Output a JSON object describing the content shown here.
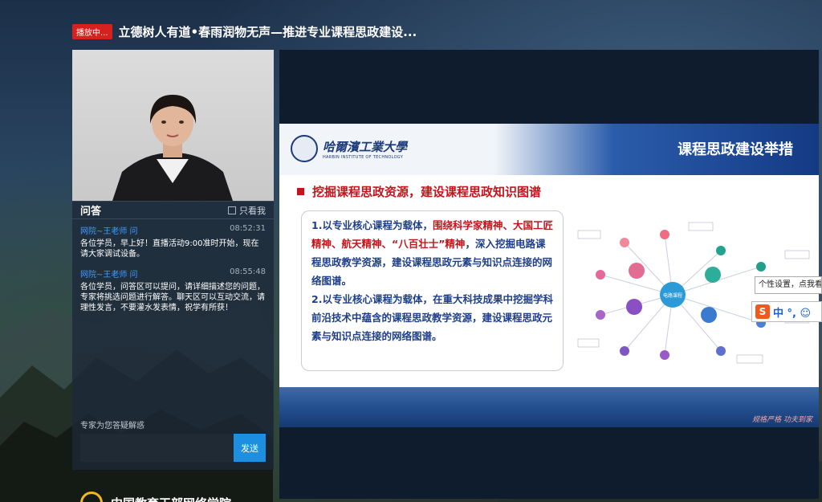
{
  "header": {
    "live_badge": "播放中...",
    "title": "立德树人有道•春雨润物无声—推进专业课程思政建设..."
  },
  "qa": {
    "title": "问答",
    "only_me_label": "只看我",
    "messages": [
      {
        "author": "网院~王老师 问",
        "time": "08:52:31",
        "text": "各位学员，早上好！直播活动9:00准时开始，现在请大家调试设备。"
      },
      {
        "author": "网院~王老师 问",
        "time": "08:55:48",
        "text": "各位学员，问答区可以提问，请详细描述您的问题，专家将挑选问题进行解答。聊天区可以互动交流，请理性发言，不要灌水发表情，祝学有所获！"
      }
    ],
    "ask_label": "专家为您答疑解惑",
    "input_value": "",
    "send_label": "发送"
  },
  "brand": {
    "text": "中国教育干部网络学院"
  },
  "slide": {
    "university_cn": "哈爾濱工業大學",
    "university_en": "HARBIN INSTITUTE OF TECHNOLOGY",
    "heading": "课程思政建设举措",
    "subheading": "挖掘课程思政资源，建设课程思政知识图谱",
    "point1_prefix": "1.以专业核心课程为载体，",
    "point1_highlight": "围绕科学家精神、大国工匠精神、航天精神、“八百壮士”精神",
    "point1_suffix": "，深入挖掘电路课程思政教学资源，建设课程思政元素与知识点连接的网络图谱。",
    "point2": "2.以专业核心课程为载体，在重大科技成果中挖掘学科前沿技术中蕴含的课程思政教学资源，建设课程思政元素与知识点连接的网络图谱。",
    "diagram_center": "电路课程",
    "footer": "规格严格 功夫到家"
  },
  "ime": {
    "tooltip": "个性设置，点我看看",
    "logo": "S",
    "mode": "中 °, ☺"
  }
}
